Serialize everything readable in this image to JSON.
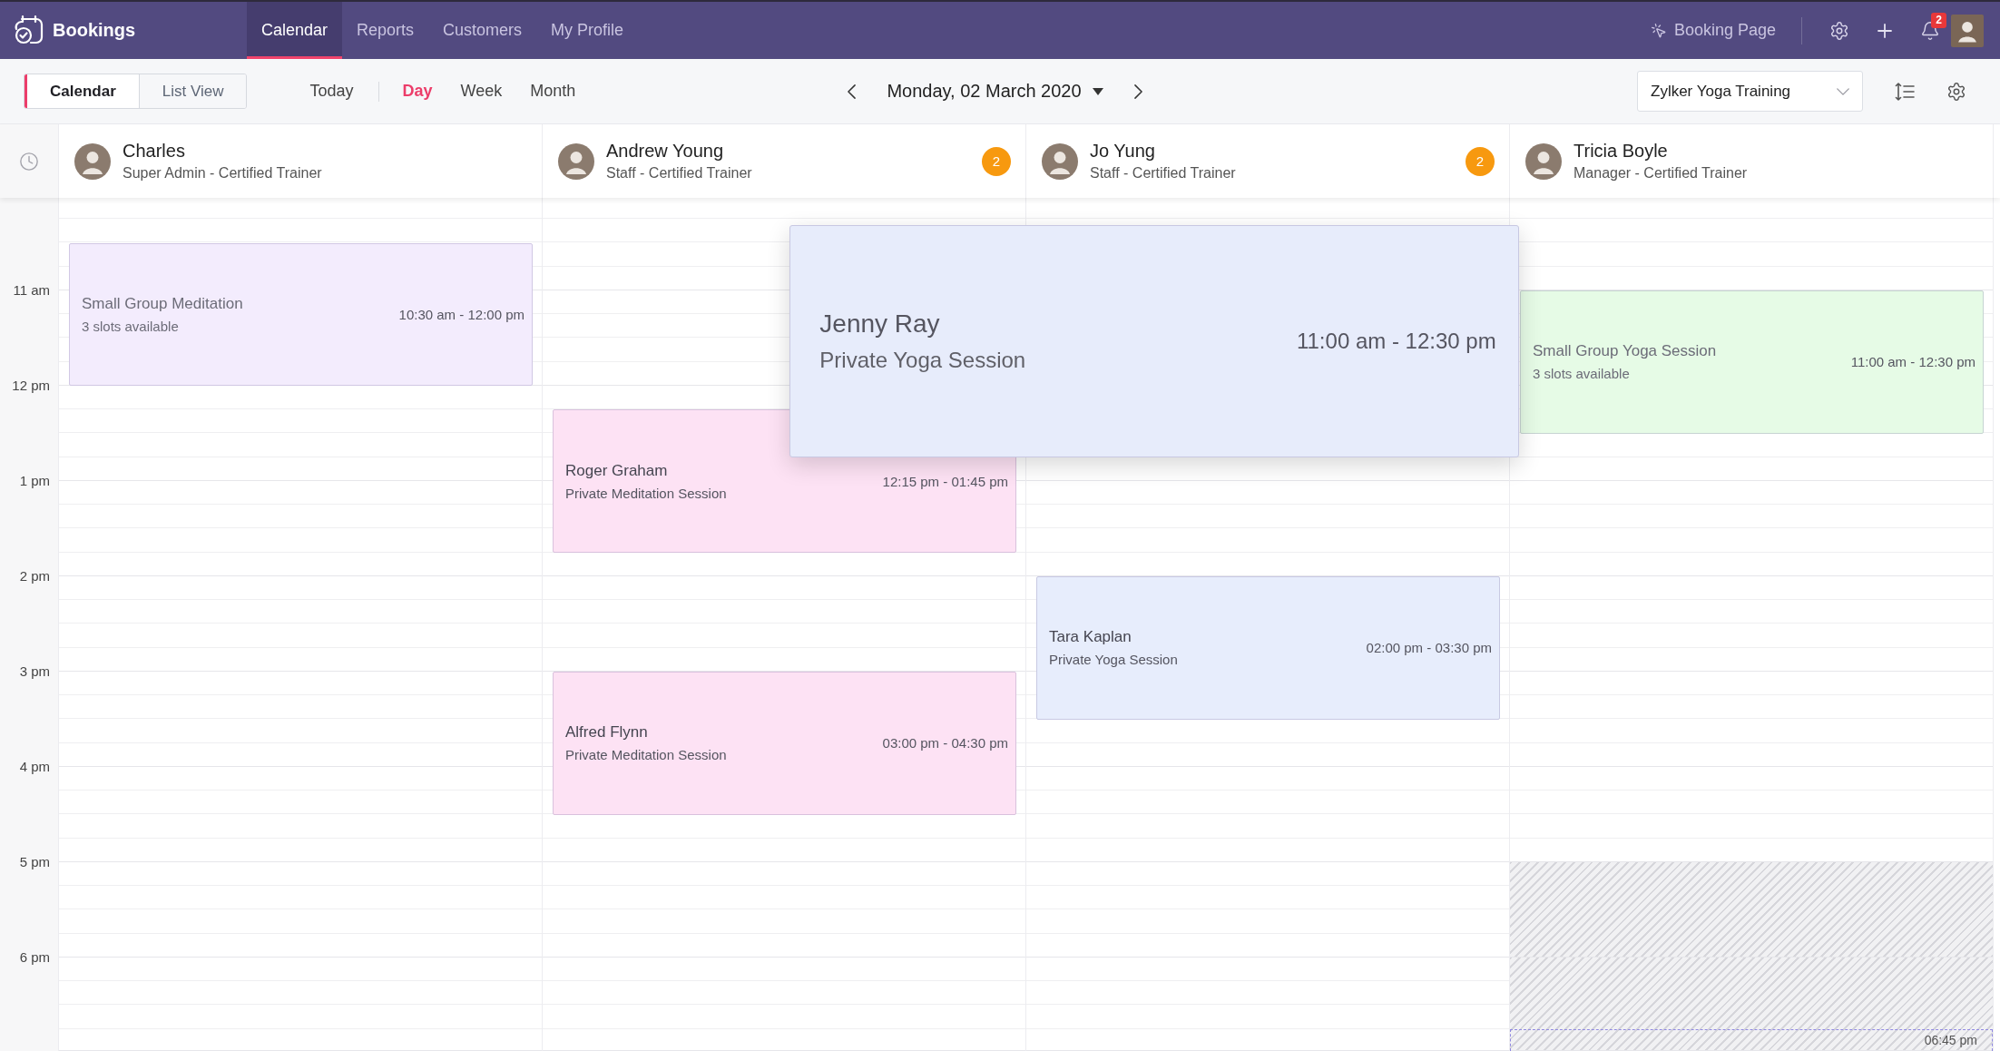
{
  "app": {
    "name": "Bookings"
  },
  "nav_tabs": [
    {
      "label": "Calendar",
      "selected": true
    },
    {
      "label": "Reports",
      "selected": false
    },
    {
      "label": "Customers",
      "selected": false
    },
    {
      "label": "My Profile",
      "selected": false
    }
  ],
  "nav_actions": {
    "booking_page": "Booking Page",
    "notifications": "2"
  },
  "view_switch": [
    {
      "label": "Calendar",
      "selected": true
    },
    {
      "label": "List View",
      "selected": false
    }
  ],
  "today": "Today",
  "ranges": [
    {
      "label": "Day",
      "selected": true
    },
    {
      "label": "Week",
      "selected": false
    },
    {
      "label": "Month",
      "selected": false
    }
  ],
  "date": "Monday, 02 March 2020",
  "workspace": {
    "value": "Zylker Yoga Training"
  },
  "hours": [
    "11 am",
    "12 pm",
    "1 pm",
    "2 pm",
    "3 pm",
    "4 pm",
    "5 pm",
    "6 pm"
  ],
  "staff": [
    {
      "name": "Charles",
      "role": "Super Admin - Certified Trainer",
      "hours_off": [
        false,
        false,
        false,
        false,
        false,
        false,
        false,
        false,
        false
      ],
      "events": [
        {
          "kind": "group",
          "title": "Small Group Meditation",
          "subtitle": "3 slots available",
          "time": "10:30 am - 12:00 pm",
          "color": "#f3ecfd",
          "expanded": false
        }
      ]
    },
    {
      "name": "Andrew Young",
      "role": "Staff - Certified Trainer",
      "count": "2",
      "hours_off": [
        false,
        false,
        false,
        false,
        false,
        false,
        false,
        false,
        false
      ],
      "events": [
        {
          "kind": "private",
          "title": "Roger Graham",
          "subtitle": "Private Meditation Session",
          "time": "12:15 pm - 01:45 pm",
          "color": "#fde2f4",
          "expanded": false
        },
        {
          "kind": "private",
          "title": "Alfred Flynn",
          "subtitle": "Private Meditation Session",
          "time": "03:00 pm - 04:30 pm",
          "color": "#fde2f4",
          "expanded": false
        }
      ]
    },
    {
      "name": "Jo Yung",
      "role": "Staff - Certified Trainer",
      "count": "2",
      "hours_off": [
        false,
        false,
        false,
        false,
        false,
        false,
        false,
        false,
        false
      ],
      "events": [
        {
          "kind": "private",
          "title": "Jenny Ray",
          "subtitle": "Private Yoga Session",
          "time": "11:00 am - 12:30 pm",
          "color": "#e7ecfb",
          "expanded": true
        },
        {
          "kind": "private",
          "title": "Tara Kaplan",
          "subtitle": "Private Yoga Session",
          "time": "02:00 pm - 03:30 pm",
          "color": "#e7edfc",
          "expanded": false
        }
      ]
    },
    {
      "name": "Tricia Boyle",
      "role": "Manager - Certified Trainer",
      "hours_off": [
        false,
        false,
        false,
        false,
        false,
        false,
        false,
        true,
        true
      ],
      "events": [
        {
          "kind": "group",
          "title": "Small Group Yoga Session",
          "subtitle": "3 slots available",
          "time": "11:00 am - 12:30 pm",
          "color": "#e6fbe6",
          "expanded": false
        },
        {
          "kind": "marker",
          "time": "06:45 pm"
        }
      ]
    }
  ]
}
